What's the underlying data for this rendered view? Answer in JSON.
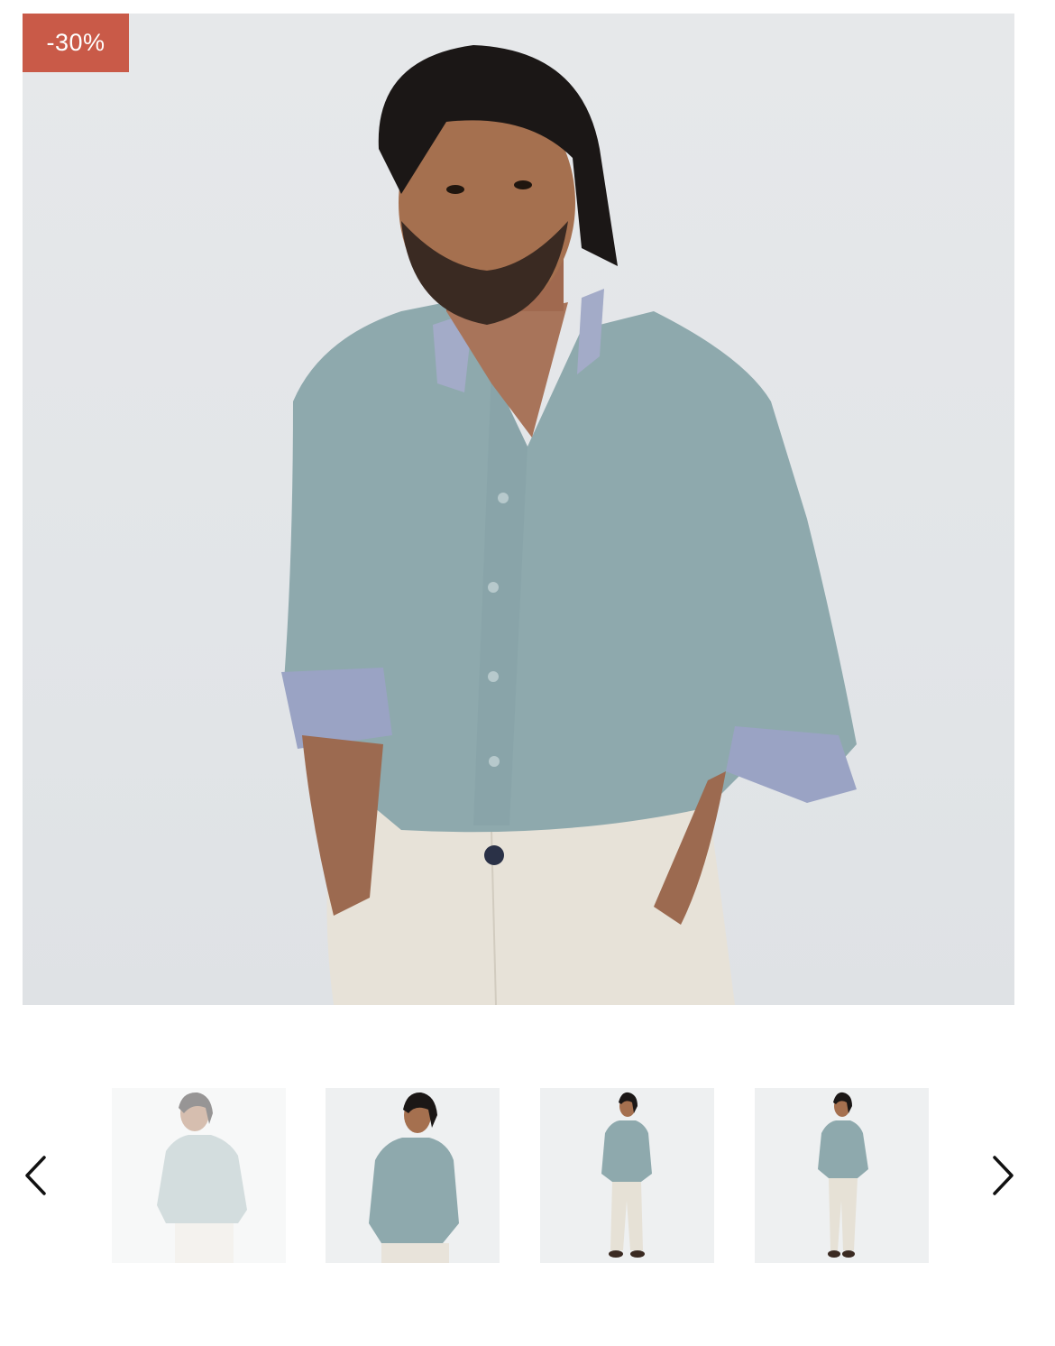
{
  "product": {
    "discount_badge": "-30%",
    "main_image_alt": "",
    "colors": {
      "badge": "#c95a48",
      "shirt": "#8fa9ac",
      "pants": "#e6e1d6",
      "background": "#e4e7ea"
    }
  },
  "gallery": {
    "thumbnails": [
      {
        "name": "thumb-1",
        "state": "inactive"
      },
      {
        "name": "thumb-2",
        "state": "active"
      },
      {
        "name": "thumb-3",
        "state": "active"
      },
      {
        "name": "thumb-4",
        "state": "active"
      }
    ],
    "prev_icon": "chevron-left-icon",
    "next_icon": "chevron-right-icon"
  }
}
